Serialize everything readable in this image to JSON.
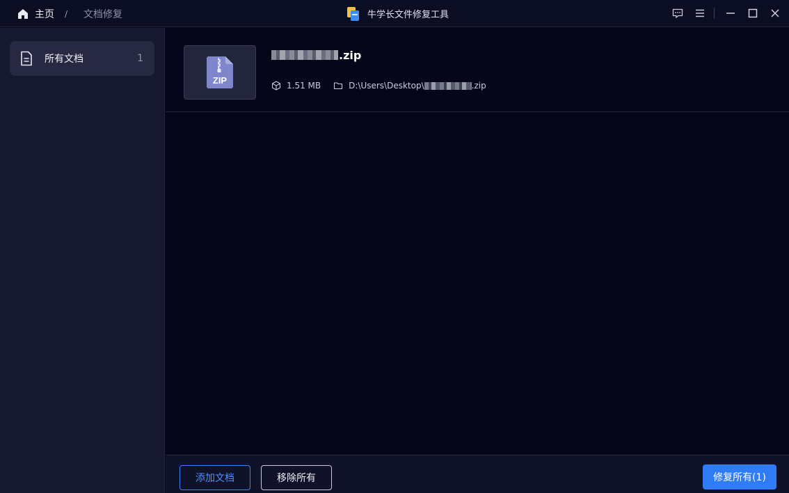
{
  "titlebar": {
    "home_label": "主页",
    "separator": "/",
    "current_page": "文档修复",
    "app_title": "牛学长文件修复工具",
    "icons": [
      "feedback-icon",
      "menu-icon",
      "minimize-icon",
      "maximize-icon",
      "close-icon"
    ]
  },
  "sidebar": {
    "items": [
      {
        "label": "所有文档",
        "count": "1",
        "icon": "document-icon"
      }
    ]
  },
  "files": [
    {
      "name_suffix": ".zip",
      "type_badge": "ZIP",
      "size": "1.51 MB",
      "path_prefix": "D:\\Users\\Desktop\\",
      "path_suffix": ".zip"
    }
  ],
  "actions": {
    "add_label": "添加文档",
    "remove_label": "移除所有",
    "repair_label": "修复所有(1)"
  },
  "colors": {
    "accent": "#2f7cf6",
    "background": "#05061a",
    "sidebar": "#16182d",
    "zip_badge": "#7f86cc"
  }
}
